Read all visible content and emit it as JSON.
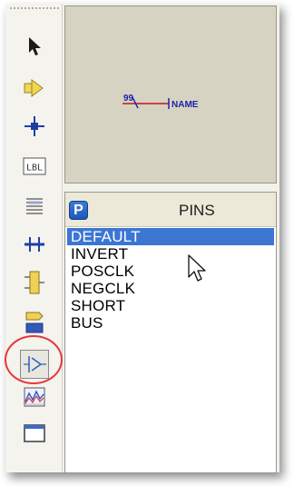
{
  "toolbar": {
    "tools": [
      {
        "name": "selection-tool",
        "icon": "arrow-pointer-icon"
      },
      {
        "name": "component-tool",
        "icon": "component-arrow-icon"
      },
      {
        "name": "junction-tool",
        "icon": "junction-dot-icon"
      },
      {
        "name": "label-tool",
        "icon": "lbl-icon",
        "text": "LBL"
      },
      {
        "name": "text-script-tool",
        "icon": "text-lines-icon"
      },
      {
        "name": "bus-tool",
        "icon": "bus-icon"
      },
      {
        "name": "subcircuit-tool",
        "icon": "subcircuit-icon"
      },
      {
        "name": "terminal-tool",
        "icon": "terminal-icon"
      },
      {
        "name": "device-pin-tool",
        "icon": "device-pin-icon",
        "active": true
      },
      {
        "name": "graph-tool",
        "icon": "graph-icon"
      },
      {
        "name": "tape-tool",
        "icon": "window-icon"
      }
    ]
  },
  "preview": {
    "pin_number": "99",
    "pin_name": "NAME"
  },
  "pins_panel": {
    "badge": "P",
    "title": "PINS",
    "items": [
      "DEFAULT",
      "INVERT",
      "POSCLK",
      "NEGCLK",
      "SHORT",
      "BUS"
    ],
    "selected_index": 0
  },
  "colors": {
    "selection": "#3b76d3",
    "highlight_ring": "#e5383b",
    "pin_wire": "#c21818",
    "pin_text": "#1a23a8",
    "preview_bg": "#d7d3c3"
  }
}
